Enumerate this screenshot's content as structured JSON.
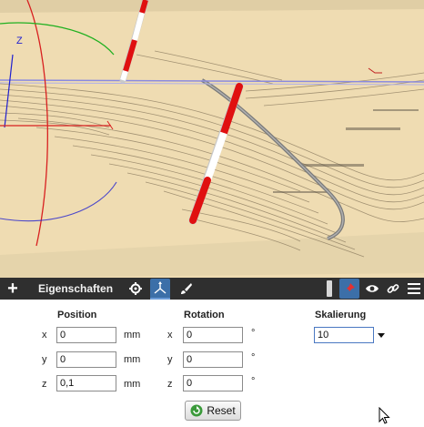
{
  "toolbar": {
    "add_label": "+",
    "title": "Eigenschaften"
  },
  "icons": {
    "add": "plus-icon",
    "settings": "gear-icon",
    "transform": "axes-icon",
    "paint": "brush-icon",
    "pin": "pin-icon",
    "visibility": "eye-icon",
    "link": "link-icon",
    "menu": "hamburger-menu-icon",
    "reset": "reset-icon"
  },
  "colors": {
    "viewport_bg": "#efdcb2",
    "toolbar_bg": "#2f2f2f",
    "active_button": "#3c6fa8",
    "axis_x": "#d82020",
    "axis_y": "#20b020",
    "axis_z": "#2020d0"
  },
  "viewport": {
    "axis_label_z": "Z"
  },
  "panel": {
    "position": {
      "header": "Position",
      "rows": [
        {
          "axis": "x",
          "value": "0",
          "unit": "mm"
        },
        {
          "axis": "y",
          "value": "0",
          "unit": "mm"
        },
        {
          "axis": "z",
          "value": "0,1",
          "unit": "mm"
        }
      ]
    },
    "rotation": {
      "header": "Rotation",
      "rows": [
        {
          "axis": "x",
          "value": "0",
          "unit": "°"
        },
        {
          "axis": "y",
          "value": "0",
          "unit": "°"
        },
        {
          "axis": "z",
          "value": "0",
          "unit": "°"
        }
      ]
    },
    "scale": {
      "header": "Skalierung",
      "value": "10"
    },
    "reset_label": "Reset"
  }
}
